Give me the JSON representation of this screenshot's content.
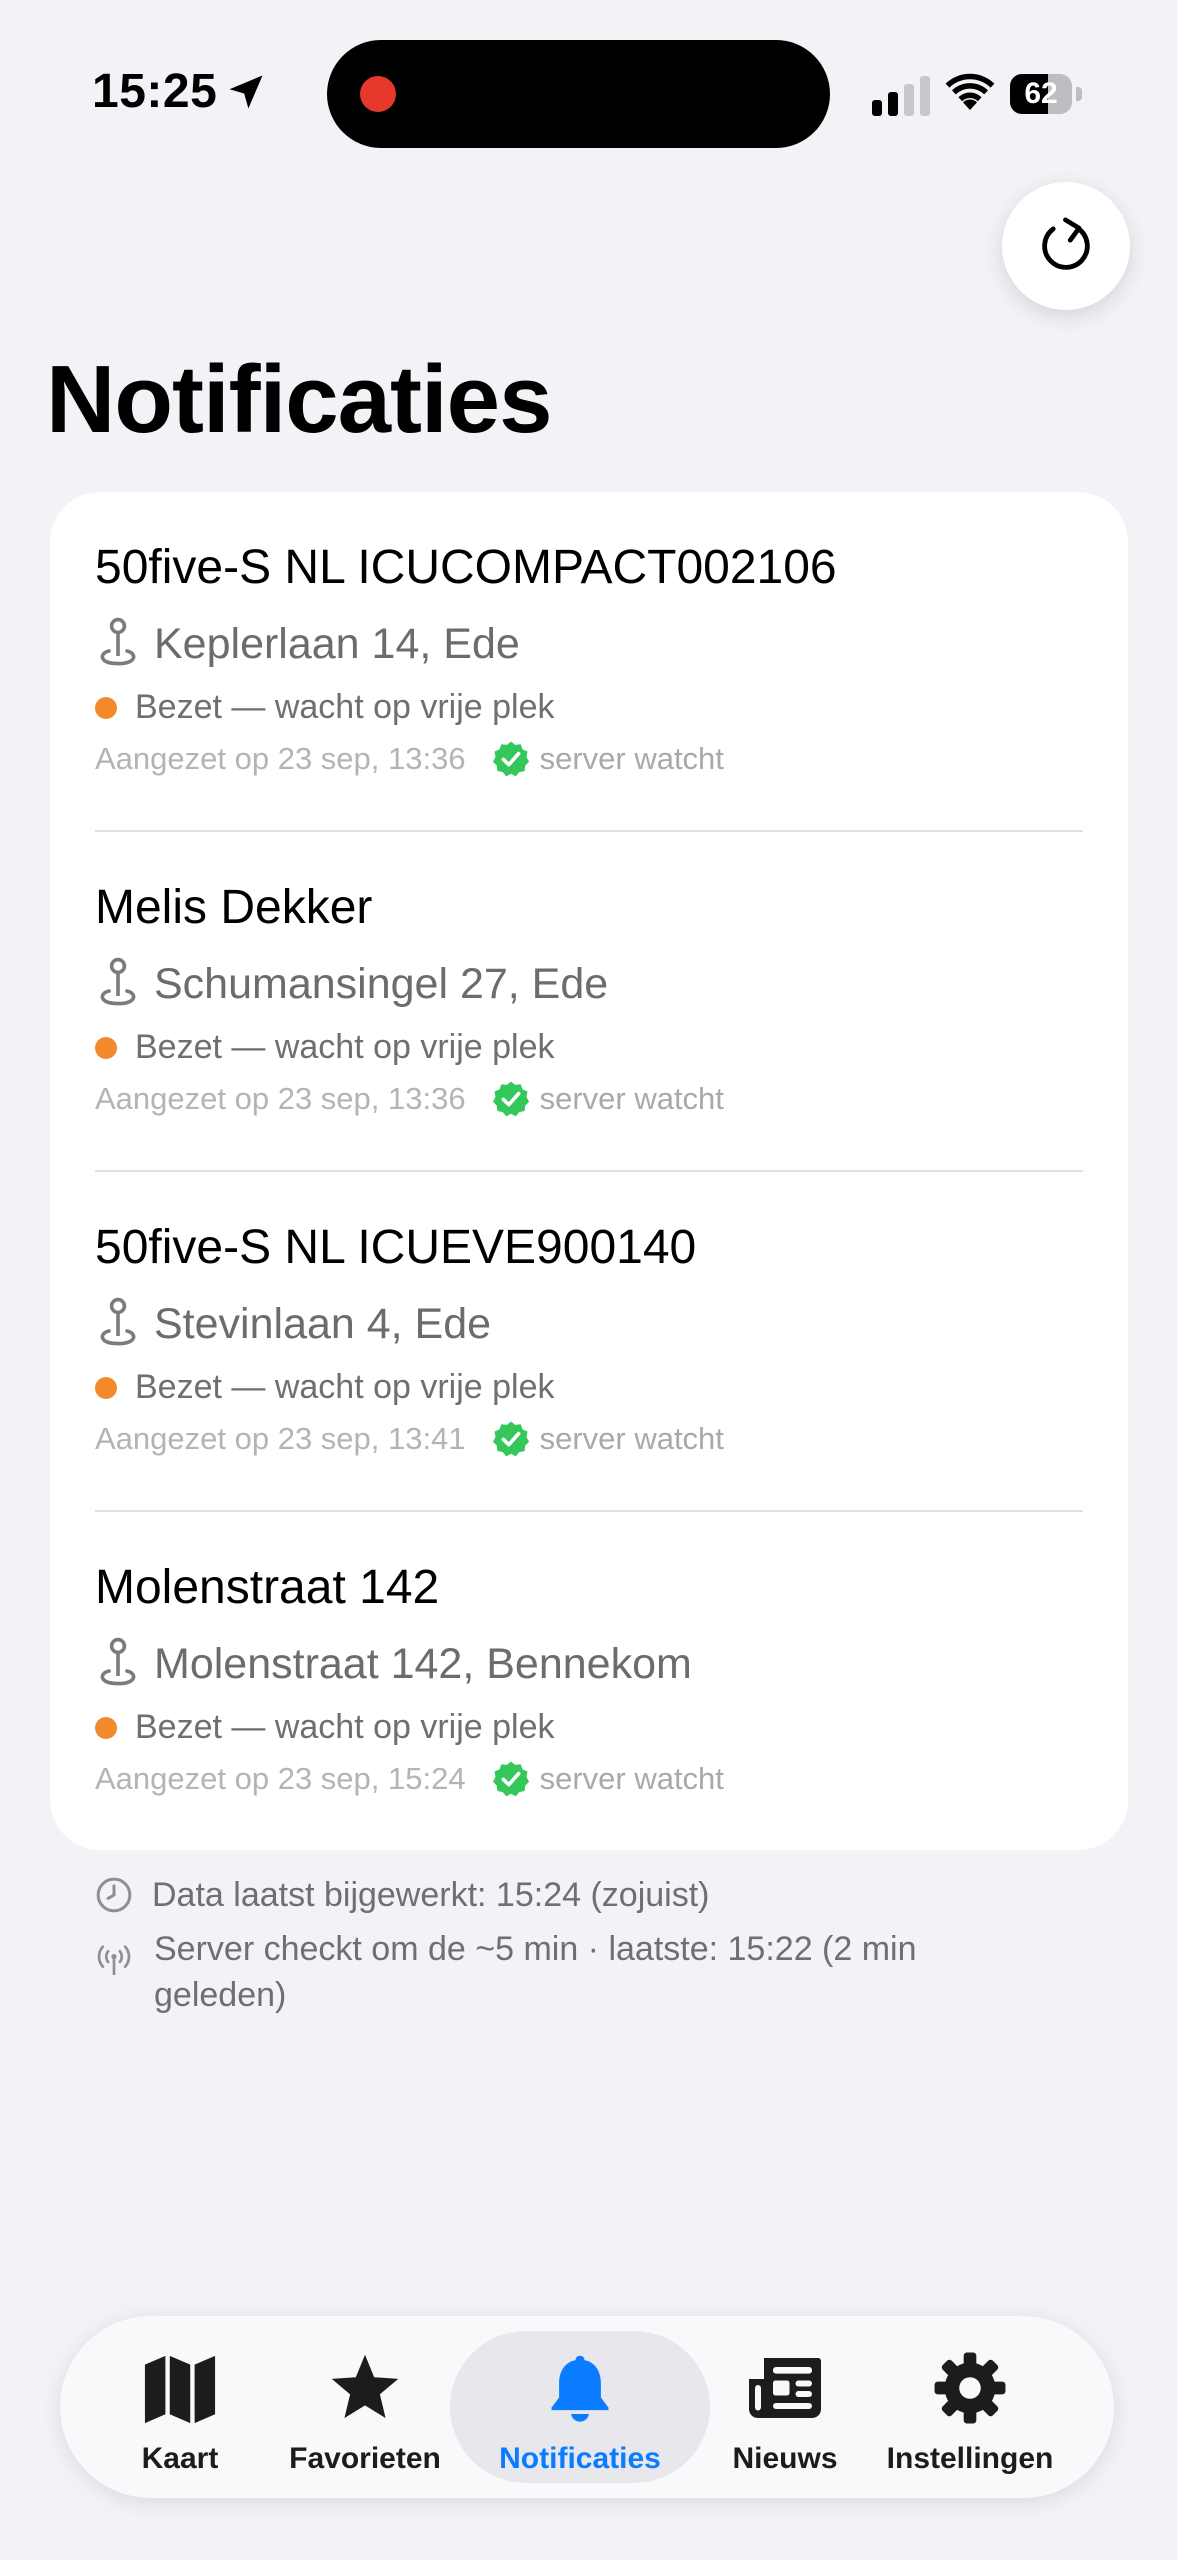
{
  "status_bar": {
    "time": "15:25",
    "battery": "62",
    "battery_level": 0.62
  },
  "page": {
    "title": "Notificaties"
  },
  "notifications": [
    {
      "title": "50five-S NL ICUCOMPACT002106",
      "address": "Keplerlaan 14, Ede",
      "state": "Bezet — wacht op vrije plek",
      "activated": "Aangezet op 23 sep, 13:36",
      "server": "server watcht"
    },
    {
      "title": "Melis Dekker",
      "address": "Schumansingel 27, Ede",
      "state": "Bezet — wacht op vrije plek",
      "activated": "Aangezet op 23 sep, 13:36",
      "server": "server watcht"
    },
    {
      "title": "50five-S NL ICUEVE900140",
      "address": "Stevinlaan 4, Ede",
      "state": "Bezet — wacht op vrije plek",
      "activated": "Aangezet op 23 sep, 13:41",
      "server": "server watcht"
    },
    {
      "title": "Molenstraat 142",
      "address": "Molenstraat 142, Bennekom",
      "state": "Bezet — wacht op vrije plek",
      "activated": "Aangezet op 23 sep, 15:24",
      "server": "server watcht"
    }
  ],
  "footer": {
    "last_updated": "Data laatst bijgewerkt: 15:24 (zojuist)",
    "server_check": "Server checkt om de ~5 min · laatste: 15:22 (2 min geleden)"
  },
  "tabs": [
    {
      "label": "Kaart",
      "icon": "map-icon"
    },
    {
      "label": "Favorieten",
      "icon": "star-icon"
    },
    {
      "label": "Notificaties",
      "icon": "bell-icon",
      "active": true
    },
    {
      "label": "Nieuws",
      "icon": "newspaper-icon"
    },
    {
      "label": "Instellingen",
      "icon": "gear-icon"
    }
  ],
  "colors": {
    "accent": "#0a7cff",
    "status_busy": "#f28a2c",
    "verified": "#34c759",
    "recording": "#e5372c"
  }
}
